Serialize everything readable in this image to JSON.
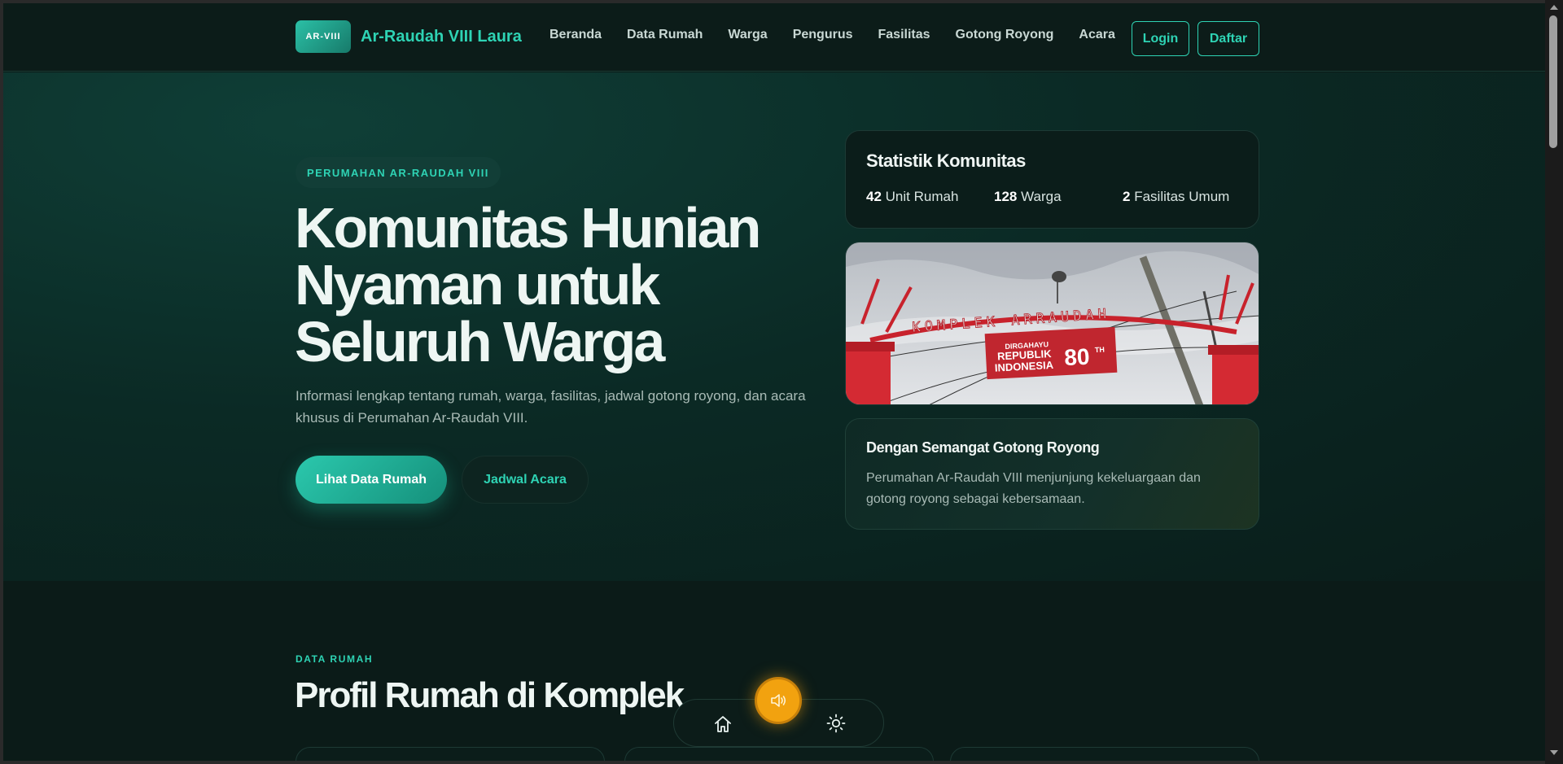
{
  "header": {
    "logo_badge": "AR-VIII",
    "brand_name": "Ar-Raudah VIII Laura",
    "nav": [
      "Beranda",
      "Data Rumah",
      "Warga",
      "Pengurus",
      "Fasilitas",
      "Gotong Royong",
      "Acara"
    ],
    "login_label": "Login",
    "register_label": "Daftar"
  },
  "hero": {
    "pill": "PERUMAHAN AR-RAUDAH VIII",
    "title": "Komunitas Hunian Nyaman untuk Seluruh Warga",
    "description": "Informasi lengkap tentang rumah, warga, fasilitas, jadwal gotong royong, dan acara khusus di Perumahan Ar-Raudah VIII.",
    "primary_button": "Lihat Data Rumah",
    "secondary_button": "Jadwal Acara"
  },
  "stats": {
    "title": "Statistik Komunitas",
    "items": [
      {
        "value": "42",
        "label": "Unit Rumah"
      },
      {
        "value": "128",
        "label": "Warga"
      },
      {
        "value": "2",
        "label": "Fasilitas Umum"
      }
    ]
  },
  "photo": {
    "gate_text": "KOMPLEK ARRAUDAH",
    "banner_line1": "DIRGAHAYU",
    "banner_line2": "REPUBLIK",
    "banner_line3": "INDONESIA",
    "banner_number": "80",
    "banner_suffix": "TH"
  },
  "info_card": {
    "title": "Dengan Semangat Gotong Royong",
    "description": "Perumahan Ar-Raudah VIII menjunjung kekeluargaan dan gotong royong sebagai kebersamaan."
  },
  "section": {
    "label": "DATA RUMAH",
    "title": "Profil Rumah di Komplek"
  },
  "icons": {
    "home": "home-icon",
    "sun": "sun-icon",
    "fab": "speaker-icon"
  },
  "colors": {
    "accent": "#2ed3b4",
    "fab": "#f2a20f",
    "background": "#0b1b18"
  }
}
